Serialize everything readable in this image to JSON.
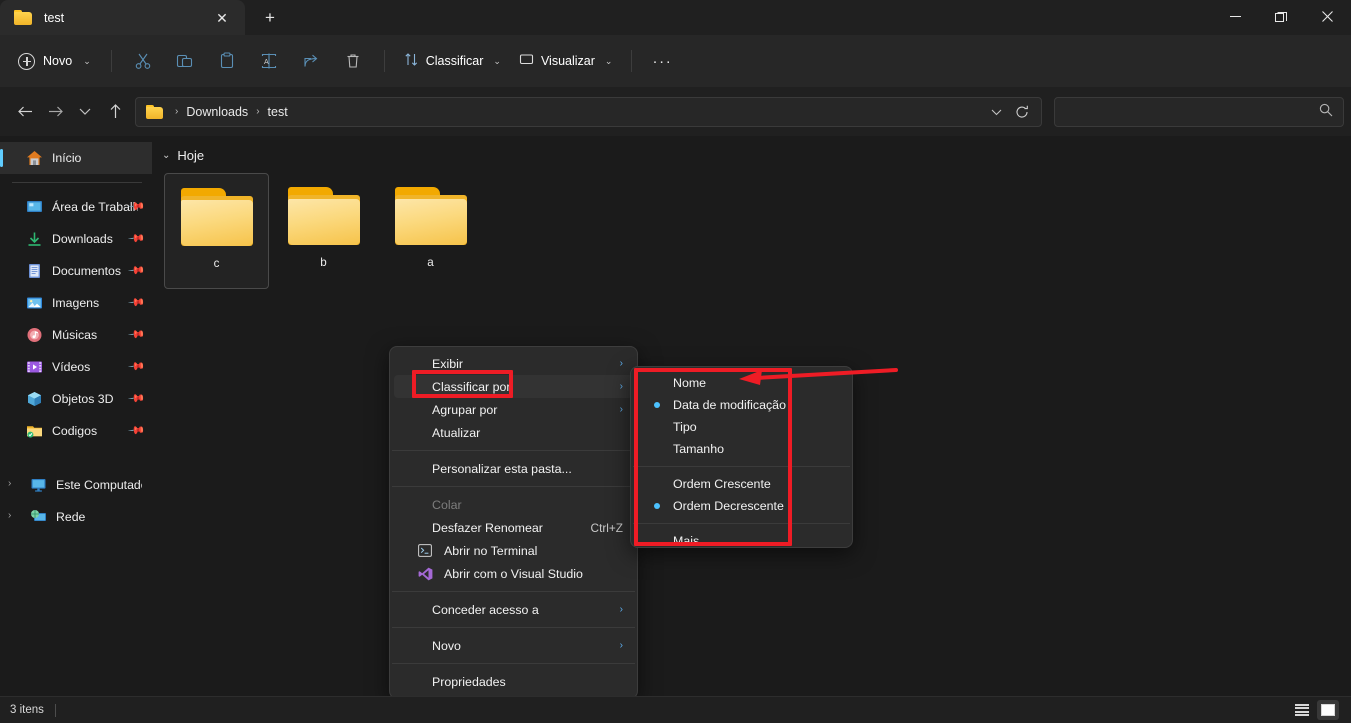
{
  "window": {
    "tab_title": "test",
    "tab_folder_icon": "folder-icon",
    "close_tab_icon": "close-icon",
    "new_tab_icon": "plus-icon",
    "minimize_icon": "minimize-icon",
    "maximize_icon": "restore-icon",
    "close_icon": "close-icon"
  },
  "toolbar": {
    "new_label": "Novo",
    "new_icon": "plus-circle-icon",
    "cut_icon": "cut-icon",
    "copy_icon": "copy-icon",
    "paste_icon": "paste-icon",
    "rename_icon": "rename-icon",
    "share_icon": "share-icon",
    "delete_icon": "trash-icon",
    "sort_label": "Classificar",
    "sort_icon": "sort-arrows-icon",
    "view_label": "Visualizar",
    "view_icon": "monitor-icon",
    "more_label": "···",
    "chevron": "⌄"
  },
  "address": {
    "back_icon": "arrow-left-icon",
    "forward_icon": "arrow-right-icon",
    "recent_icon": "chevron-down-icon",
    "up_icon": "arrow-up-icon",
    "folder_icon": "folder-icon",
    "crumbs": [
      "Downloads",
      "test"
    ],
    "separator": "›",
    "dropdown_icon": "chevron-down-icon",
    "refresh_icon": "refresh-icon",
    "search_value": "",
    "search_placeholder": "",
    "search_icon": "search-icon"
  },
  "sidebar": {
    "home": {
      "label": "Início",
      "icon": "home-icon"
    },
    "quick_items": [
      {
        "label": "Área de Trabalho",
        "icon": "desktop-icon",
        "pinned": true
      },
      {
        "label": "Downloads",
        "icon": "download-icon",
        "pinned": true
      },
      {
        "label": "Documentos",
        "icon": "documents-icon",
        "pinned": true
      },
      {
        "label": "Imagens",
        "icon": "pictures-icon",
        "pinned": true
      },
      {
        "label": "Músicas",
        "icon": "music-icon",
        "pinned": true
      },
      {
        "label": "Vídeos",
        "icon": "videos-icon",
        "pinned": true
      },
      {
        "label": "Objetos 3D",
        "icon": "cube-icon",
        "pinned": true
      },
      {
        "label": "Codigos",
        "icon": "folder-sync-icon",
        "pinned": true
      }
    ],
    "tree_items": [
      {
        "label": "Este Computador",
        "icon": "computer-icon",
        "expand": "›"
      },
      {
        "label": "Rede",
        "icon": "network-icon",
        "expand": "›"
      }
    ],
    "pin_icon": "pin-icon"
  },
  "main": {
    "group_label": "Hoje",
    "group_chevron": "⌄",
    "files": [
      {
        "name": "c",
        "icon": "folder-icon",
        "selected": true
      },
      {
        "name": "b",
        "icon": "folder-icon",
        "selected": false
      },
      {
        "name": "a",
        "icon": "folder-icon",
        "selected": false
      }
    ]
  },
  "status": {
    "item_count": "3 itens",
    "list_view_icon": "list-view-icon",
    "tile_view_icon": "tile-view-icon"
  },
  "context_menu": {
    "items": [
      {
        "label": "Exibir",
        "submenu": true,
        "highlighted": false
      },
      {
        "label": "Classificar por",
        "submenu": true,
        "highlighted": true
      },
      {
        "label": "Agrupar por",
        "submenu": true,
        "highlighted": false
      },
      {
        "label": "Atualizar",
        "submenu": false,
        "highlighted": false
      },
      {
        "divider": true
      },
      {
        "label": "Personalizar esta pasta...",
        "submenu": false
      },
      {
        "divider": true
      },
      {
        "label": "Colar",
        "disabled": true
      },
      {
        "label": "Desfazer Renomear",
        "accel": "Ctrl+Z"
      },
      {
        "label": "Abrir no Terminal",
        "icon": "terminal-icon"
      },
      {
        "label": "Abrir com o Visual Studio",
        "icon": "visual-studio-icon"
      },
      {
        "divider": true
      },
      {
        "label": "Conceder acesso a",
        "submenu": true
      },
      {
        "divider": true
      },
      {
        "label": "Novo",
        "submenu": true
      },
      {
        "divider": true
      },
      {
        "label": "Propriedades",
        "submenu": false
      }
    ],
    "submenu_arrow": "›"
  },
  "sort_submenu": {
    "items": [
      {
        "label": "Nome",
        "checked": false
      },
      {
        "label": "Data de modificação",
        "checked": true
      },
      {
        "label": "Tipo",
        "checked": false
      },
      {
        "label": "Tamanho",
        "checked": false
      },
      {
        "divider": true
      },
      {
        "label": "Ordem Crescente",
        "checked": false
      },
      {
        "label": "Ordem Decrescente",
        "checked": true
      },
      {
        "divider": true
      },
      {
        "label": "Mais...",
        "checked": false
      }
    ]
  },
  "annotations": {
    "highlight_color": "#ee1c25",
    "boxes": [
      "classificar-por-item",
      "sort-submenu-panel"
    ],
    "arrow": "points-left-to-nome-item"
  }
}
